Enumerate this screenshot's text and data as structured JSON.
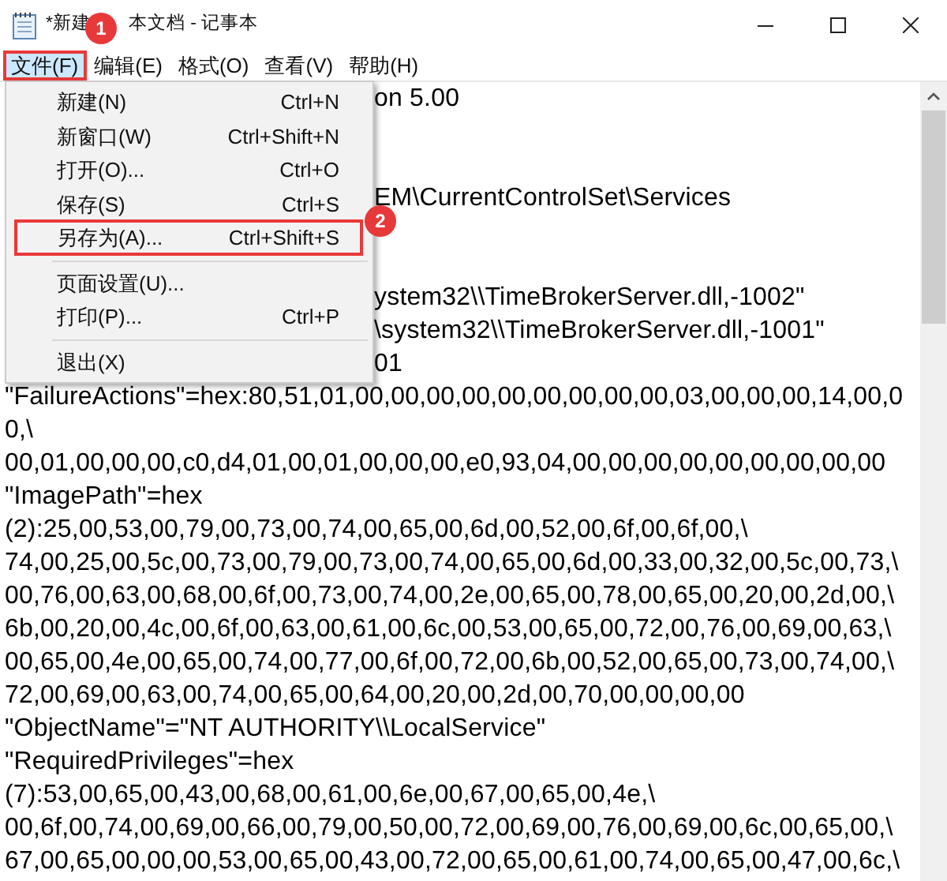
{
  "window": {
    "title_parts": [
      "*新建",
      "本文档 - 记事本"
    ]
  },
  "menu_bar": [
    {
      "label": "文件(F)",
      "selected": true,
      "step_badge": "1"
    },
    {
      "label": "编辑(E)",
      "selected": false
    },
    {
      "label": "格式(O)",
      "selected": false
    },
    {
      "label": "查看(V)",
      "selected": false
    },
    {
      "label": "帮助(H)",
      "selected": false
    }
  ],
  "file_menu": [
    {
      "kind": "item",
      "label": "新建(N)",
      "shortcut": "Ctrl+N"
    },
    {
      "kind": "item",
      "label": "新窗口(W)",
      "shortcut": "Ctrl+Shift+N"
    },
    {
      "kind": "item",
      "label": "打开(O)...",
      "shortcut": "Ctrl+O"
    },
    {
      "kind": "item",
      "label": "保存(S)",
      "shortcut": "Ctrl+S"
    },
    {
      "kind": "item",
      "label": "另存为(A)...",
      "shortcut": "Ctrl+Shift+S",
      "step_badge": "2"
    },
    {
      "kind": "separator"
    },
    {
      "kind": "item",
      "label": "页面设置(U)..."
    },
    {
      "kind": "item",
      "label": "打印(P)...",
      "shortcut": "Ctrl+P"
    },
    {
      "kind": "separator"
    },
    {
      "kind": "item",
      "label": "退出(X)"
    }
  ],
  "editor_lines": [
    {
      "kind": "partial",
      "text": "on 5.00"
    },
    {
      "kind": "blank"
    },
    {
      "kind": "blank"
    },
    {
      "kind": "partial",
      "text": "EM\\CurrentControlSet\\Services"
    },
    {
      "kind": "blank"
    },
    {
      "kind": "blank"
    },
    {
      "kind": "partial",
      "text": "ystem32\\\\TimeBrokerServer.dll,-1002\""
    },
    {
      "kind": "partial",
      "text": "\\system32\\\\TimeBrokerServer.dll,-1001\""
    },
    {
      "kind": "partial",
      "text": "01"
    },
    {
      "kind": "text",
      "text": "\"FailureActions\"=hex:80,51,01,00,00,00,00,00,00,00,00,00,03,00,00,00,14,00,0"
    },
    {
      "kind": "text",
      "text": "0,\\"
    },
    {
      "kind": "text",
      "text": "00,01,00,00,00,c0,d4,01,00,01,00,00,00,e0,93,04,00,00,00,00,00,00,00,00,00"
    },
    {
      "kind": "text",
      "text": "\"ImagePath\"=hex"
    },
    {
      "kind": "text",
      "text": "(2):25,00,53,00,79,00,73,00,74,00,65,00,6d,00,52,00,6f,00,6f,00,\\"
    },
    {
      "kind": "text",
      "text": "74,00,25,00,5c,00,73,00,79,00,73,00,74,00,65,00,6d,00,33,00,32,00,5c,00,73,\\"
    },
    {
      "kind": "text",
      "text": "00,76,00,63,00,68,00,6f,00,73,00,74,00,2e,00,65,00,78,00,65,00,20,00,2d,00,\\"
    },
    {
      "kind": "text",
      "text": "6b,00,20,00,4c,00,6f,00,63,00,61,00,6c,00,53,00,65,00,72,00,76,00,69,00,63,\\"
    },
    {
      "kind": "text",
      "text": "00,65,00,4e,00,65,00,74,00,77,00,6f,00,72,00,6b,00,52,00,65,00,73,00,74,00,\\"
    },
    {
      "kind": "text",
      "text": "72,00,69,00,63,00,74,00,65,00,64,00,20,00,2d,00,70,00,00,00,00"
    },
    {
      "kind": "text",
      "text": "\"ObjectName\"=\"NT AUTHORITY\\\\LocalService\""
    },
    {
      "kind": "text",
      "text": "\"RequiredPrivileges\"=hex"
    },
    {
      "kind": "text",
      "text": "(7):53,00,65,00,43,00,68,00,61,00,6e,00,67,00,65,00,4e,\\"
    },
    {
      "kind": "text",
      "text": "00,6f,00,74,00,69,00,66,00,79,00,50,00,72,00,69,00,76,00,69,00,6c,00,65,00,\\"
    },
    {
      "kind": "text",
      "text": "67,00,65,00,00,00,53,00,65,00,43,00,72,00,65,00,61,00,74,00,65,00,47,00,6c,\\"
    }
  ]
}
